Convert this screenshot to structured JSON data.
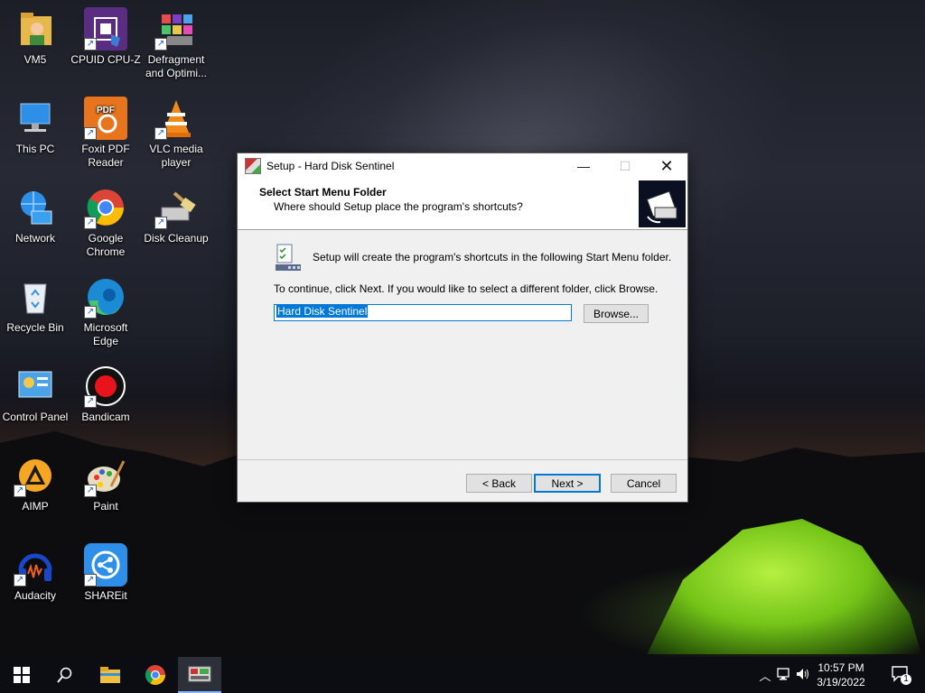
{
  "desktop": {
    "icons": [
      {
        "label": "VM5",
        "icon": "user-folder-icon"
      },
      {
        "label": "CPUID CPU-Z",
        "icon": "cpu-z-icon"
      },
      {
        "label": "Defragment and Optimi...",
        "icon": "defragment-icon"
      },
      {
        "label": "This PC",
        "icon": "this-pc-icon"
      },
      {
        "label": "Foxit PDF Reader",
        "icon": "foxit-pdf-icon"
      },
      {
        "label": "VLC media player",
        "icon": "vlc-icon"
      },
      {
        "label": "Network",
        "icon": "network-icon"
      },
      {
        "label": "Google Chrome",
        "icon": "chrome-icon"
      },
      {
        "label": "Disk Cleanup",
        "icon": "disk-cleanup-icon"
      },
      {
        "label": "Recycle Bin",
        "icon": "recycle-bin-icon"
      },
      {
        "label": "Microsoft Edge",
        "icon": "edge-icon"
      },
      {
        "label": "Control Panel",
        "icon": "control-panel-icon"
      },
      {
        "label": "Bandicam",
        "icon": "bandicam-icon"
      },
      {
        "label": "AIMP",
        "icon": "aimp-icon"
      },
      {
        "label": "Paint",
        "icon": "paint-icon"
      },
      {
        "label": "Audacity",
        "icon": "audacity-icon"
      },
      {
        "label": "SHAREit",
        "icon": "shareit-icon"
      }
    ]
  },
  "dialog": {
    "title": "Setup - Hard Disk Sentinel",
    "header_title": "Select Start Menu Folder",
    "header_subtitle": "Where should Setup place the program's shortcuts?",
    "info_text": "Setup will create the program's shortcuts in the following Start Menu folder.",
    "continue_text": "To continue, click Next. If you would like to select a different folder, click Browse.",
    "folder_value": "Hard Disk Sentinel",
    "browse_label": "Browse...",
    "back_label": "< Back",
    "next_label": "Next >",
    "cancel_label": "Cancel"
  },
  "taskbar": {
    "clock_time": "10:57 PM",
    "clock_date": "3/19/2022",
    "notification_count": "1"
  },
  "colors": {
    "accent": "#0078d7",
    "taskbar": "#0b0d12"
  }
}
